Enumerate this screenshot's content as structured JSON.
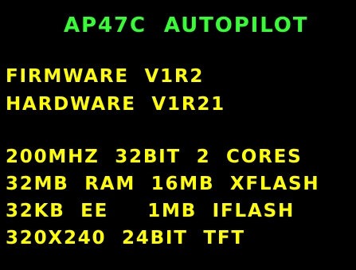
{
  "colors": {
    "background": "#000000",
    "title": "#33ff33",
    "text": "#ffff00"
  },
  "title": "AP47C  AUTOPILOT",
  "version": {
    "firmware": "FIRMWARE  V1R2",
    "hardware": "HARDWARE  V1R21"
  },
  "specs": {
    "cpu": "200MHZ  32BIT  2  CORES",
    "memory": "32MB  RAM  16MB  XFLASH",
    "storage": "32KB  EE     1MB  IFLASH",
    "display": "320X240  24BIT  TFT"
  }
}
